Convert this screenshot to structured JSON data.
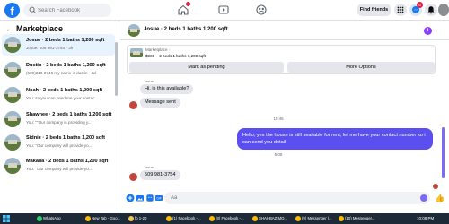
{
  "topbar": {
    "logo": "f",
    "search_placeholder": "Search Facebook",
    "find_friends": "Find friends",
    "notif_count": "6",
    "icons": [
      "home-icon",
      "video-icon",
      "groups-icon",
      "apps-grid-icon",
      "messenger-icon",
      "bell-icon"
    ]
  },
  "sidebar": {
    "back": "←",
    "title": "Marketplace",
    "conversations": [
      {
        "title": "Josue · 2 beds 1 baths 1,200 sqft",
        "subtitle": "Josue: 509 981-3754 · 3h"
      },
      {
        "title": "Dustin · 2 beds 1 baths 1,200 sqft",
        "subtitle": "(509)216-8748 my name is dustin · 2d"
      },
      {
        "title": "Noah · 2 beds 1 baths 1,200 sqft",
        "subtitle": "You: so you can send me your contac..."
      },
      {
        "title": "Shawnee · 2 beds 1 baths 1,200 sqft",
        "subtitle": "You: \"\"Our company is providing y..."
      },
      {
        "title": "Sidnie · 2 beds 1 baths 1,200 sqft",
        "subtitle": "You: \"Our company will provide yo..."
      },
      {
        "title": "Makaila · 2 beds 1 baths 1,200 sqft",
        "subtitle": "You: \"Our company will provide yo..."
      }
    ]
  },
  "chat": {
    "title": "Josue · 2 beds 1 baths 1,200 sqft",
    "info": "i",
    "listing": {
      "category": "Marketplace ·",
      "description": "$900 – 2 beds 1 baths 1,200 sqft",
      "pending_button": "Mark as pending",
      "more_button": "More Options"
    },
    "sender": "Josue",
    "msg1": "Hi, is this available?",
    "msg2": "Message sent",
    "time1": "10:45",
    "outgoing": "Hello, yes the house is still available for rent, let me have your contact number so i can send you detail",
    "time2": "5:05",
    "sender2": "Josue",
    "msg3": "509 981-3754",
    "composer_placeholder": "Aa"
  },
  "taskbar": {
    "items": [
      "WhatsApp",
      "New Tab - Goo...",
      "fb 1-20",
      "(1) Facebook -...",
      "(8) Facebook -...",
      "SHAHBAZ MO...",
      "(9) Messenger |...",
      "(10) Messenger..."
    ],
    "clock": "10:08 PM"
  },
  "colors": {
    "brand": "#1877f2",
    "outgoing_bubble": "#5b4ff0",
    "active_row": "#e7f3ff",
    "badge": "#e41e3f"
  }
}
